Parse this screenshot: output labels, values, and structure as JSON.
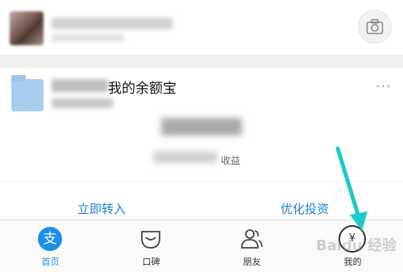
{
  "card": {
    "title": "我的余额宝",
    "earnings_label": "收益",
    "more": "···"
  },
  "actions": {
    "transfer_in": "立即转入",
    "optimize": "优化投资"
  },
  "tabs": [
    {
      "label": "首页",
      "icon": "alipay-icon",
      "active": true
    },
    {
      "label": "口碑",
      "icon": "koubei-icon",
      "active": false
    },
    {
      "label": "朋友",
      "icon": "friends-icon",
      "active": false
    },
    {
      "label": "我的",
      "icon": "wallet-icon",
      "active": false
    }
  ],
  "icons": {
    "home_glyph": "支",
    "mine_glyph": "¥"
  },
  "colors": {
    "accent": "#1e8fe6",
    "link": "#1b7fd8",
    "arrow": "#1ec9c9"
  },
  "watermark": "Baidu 经验"
}
